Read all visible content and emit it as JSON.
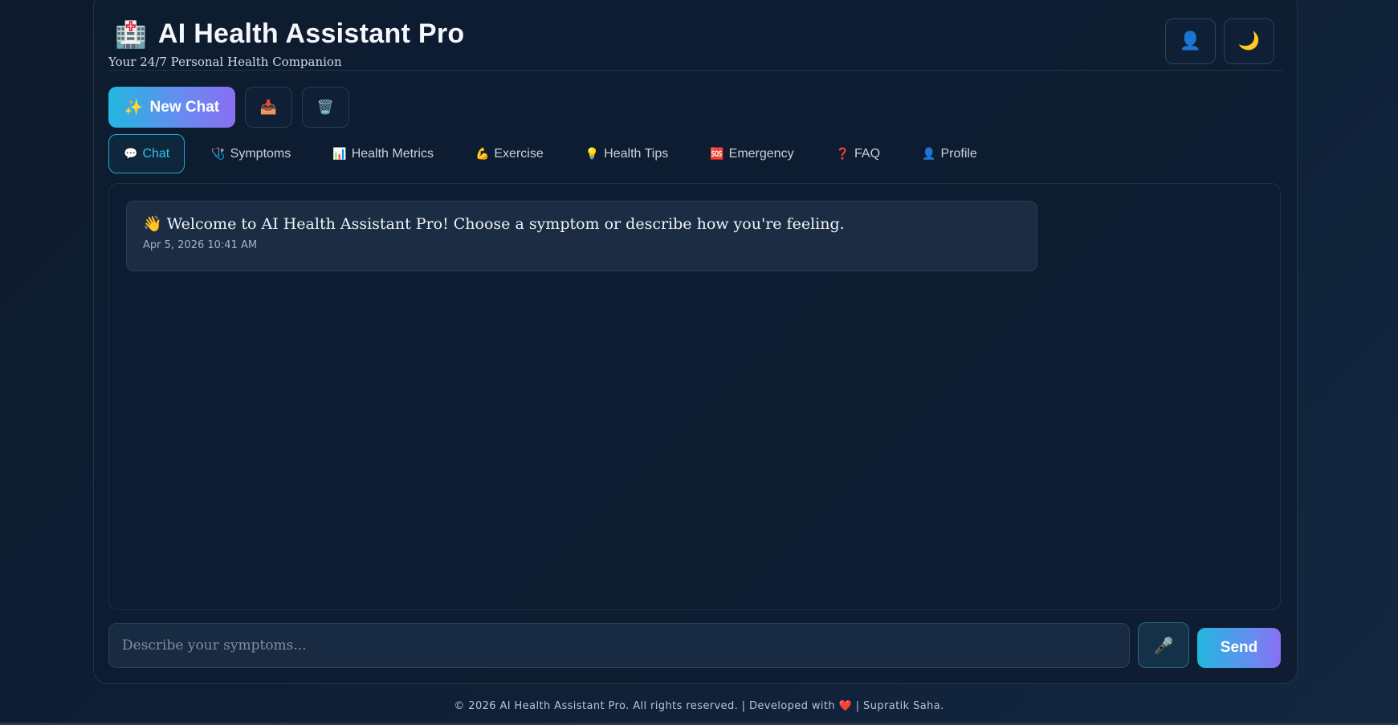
{
  "header": {
    "logo_icon": "🏥",
    "title": "AI Health Assistant Pro",
    "subtitle": "Your 24/7 Personal Health Companion",
    "user_icon": "👤",
    "theme_icon": "🌙"
  },
  "actions": {
    "new_chat_icon": "✨",
    "new_chat_label": "New Chat",
    "export_icon": "📥",
    "clear_icon": "🗑️"
  },
  "tabs": [
    {
      "icon": "💬",
      "label": "Chat",
      "active": true
    },
    {
      "icon": "🩺",
      "label": "Symptoms"
    },
    {
      "icon": "📊",
      "label": "Health Metrics"
    },
    {
      "icon": "💪",
      "label": "Exercise"
    },
    {
      "icon": "💡",
      "label": "Health Tips"
    },
    {
      "icon": "🆘",
      "label": "Emergency"
    },
    {
      "icon": "❓",
      "label": "FAQ"
    },
    {
      "icon": "👤",
      "label": "Profile"
    }
  ],
  "chat": {
    "messages": [
      {
        "icon": "👋",
        "text": "Welcome to AI Health Assistant Pro! Choose a symptom or describe how you're feeling.",
        "time": "Apr 5, 2026 10:41 AM"
      }
    ]
  },
  "input": {
    "placeholder": "Describe your symptoms...",
    "mic_icon": "🎤",
    "send_label": "Send"
  },
  "footer": {
    "text_before": "© 2026 AI Health Assistant Pro. All rights reserved. | Developed with",
    "heart": "❤️",
    "text_after": "| Supratik Saha."
  },
  "colors": {
    "accent_cyan": "#22b7e0",
    "accent_purple": "#8a6ef2",
    "background": "#0f1f35"
  }
}
